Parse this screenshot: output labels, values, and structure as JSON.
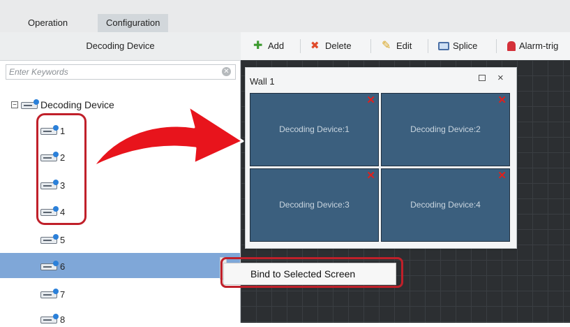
{
  "tabs": [
    {
      "label": "Operation"
    },
    {
      "label": "Configuration",
      "active": true
    }
  ],
  "left_panel": {
    "header": "Decoding Device",
    "search_placeholder": "Enter Keywords",
    "root_label": "Decoding Device",
    "expander_symbol": "−",
    "items": [
      {
        "label": "1"
      },
      {
        "label": "2"
      },
      {
        "label": "3"
      },
      {
        "label": "4"
      },
      {
        "label": "5"
      },
      {
        "label": "6",
        "selected": true
      },
      {
        "label": "7"
      },
      {
        "label": "8"
      }
    ]
  },
  "toolbar": {
    "add": "Add",
    "delete": "Delete",
    "edit": "Edit",
    "splice": "Splice",
    "alarm": "Alarm-trig"
  },
  "wall": {
    "title": "Wall 1",
    "maximize_symbol": "□",
    "close_symbol": "×",
    "remove_symbol": "✕",
    "screens": [
      {
        "label": "Decoding Device:1"
      },
      {
        "label": "Decoding Device:2"
      },
      {
        "label": "Decoding Device:3"
      },
      {
        "label": "Decoding Device:4"
      }
    ]
  },
  "context_menu": {
    "item": "Bind to Selected Screen"
  },
  "colors": {
    "highlight": "#c0202a",
    "selection": "#7fa7d8",
    "screen_fill": "#3b5f7e",
    "remove_mark": "#e0201c",
    "canvas": "#2c2f32"
  },
  "icons": {
    "clear": "clear-icon",
    "device": "decoding-device-icon",
    "add": "add-icon",
    "delete": "delete-icon",
    "edit": "edit-icon",
    "splice": "splice-icon",
    "alarm": "alarm-icon"
  }
}
